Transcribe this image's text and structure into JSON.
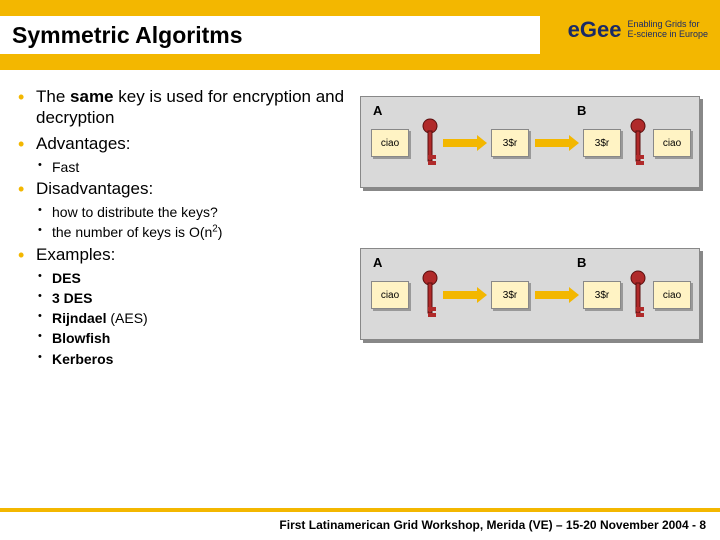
{
  "header": {
    "title": "Symmetric Algoritms",
    "logo_brand": "eGee",
    "logo_tag1": "Enabling Grids for",
    "logo_tag2": "E-science in Europe"
  },
  "bullets": {
    "b1a_pre": "The ",
    "b1a_bold": "same",
    "b1a_post": " key is used for encryption and decryption",
    "b1b": "Advantages:",
    "b2a": "Fast",
    "b1c": "Disadvantages:",
    "b2b": "how to distribute the keys?",
    "b2c_pre": "the number of keys is O(n",
    "b2c_sup": "2",
    "b2c_post": ")",
    "b1d": "Examples:",
    "ex1": "DES",
    "ex2": "3 DES",
    "ex3_bold": "Rijndael",
    "ex3_post": " (AES)",
    "ex4": "Blowfish",
    "ex5": "Kerberos"
  },
  "diagram": {
    "labelA": "A",
    "labelB": "B",
    "plain": "ciao",
    "cipher": "3$r"
  },
  "footer": "First Latinamerican Grid Workshop, Merida (VE) – 15-20 November 2004 - 8"
}
